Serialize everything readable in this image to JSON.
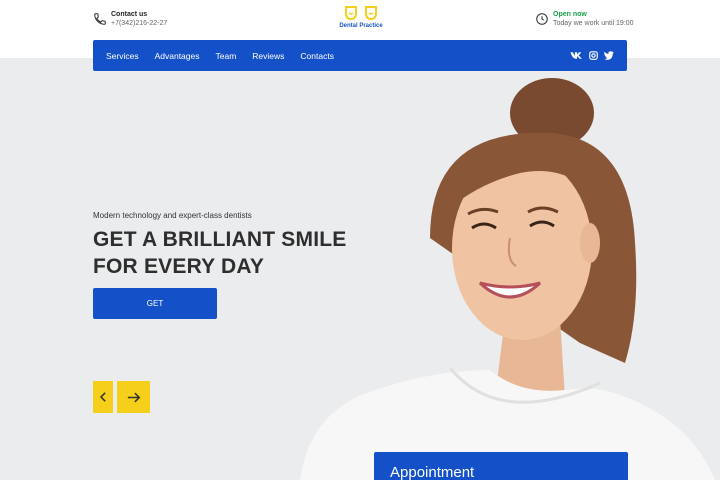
{
  "header": {
    "contact_title": "Contact us",
    "contact_phone": "+7(342)216-22-27",
    "logo_text": "Dental Practice",
    "status": "Open now",
    "hours": "Today we work until 19:00"
  },
  "nav": {
    "items": [
      {
        "label": "Services"
      },
      {
        "label": "Advantages"
      },
      {
        "label": "Team"
      },
      {
        "label": "Reviews"
      },
      {
        "label": "Contacts"
      }
    ],
    "social": [
      "vk",
      "instagram",
      "twitter"
    ]
  },
  "hero": {
    "tagline": "Modern technology and expert-class dentists",
    "title_line1": "GET A BRILLIANT SMILE",
    "title_line2": "FOR EVERY DAY",
    "cta_label": "GET",
    "prev_icon": "arrow-left-icon",
    "next_icon": "arrow-right-icon"
  },
  "appointment": {
    "title": "Appointment"
  },
  "colors": {
    "primary": "#1450c8",
    "accent": "#f5cf1a",
    "status_green": "#19a14a"
  }
}
